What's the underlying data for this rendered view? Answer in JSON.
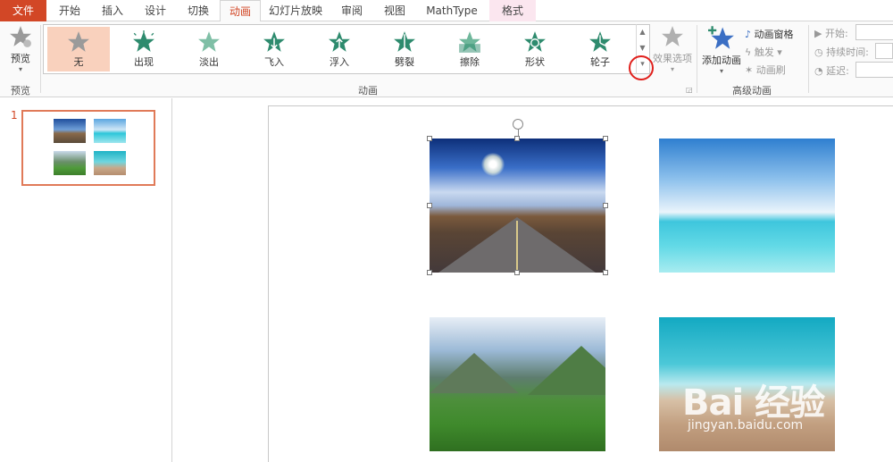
{
  "tabs": [
    {
      "label": "文件"
    },
    {
      "label": "开始"
    },
    {
      "label": "插入"
    },
    {
      "label": "设计"
    },
    {
      "label": "切换"
    },
    {
      "label": "动画"
    },
    {
      "label": "幻灯片放映"
    },
    {
      "label": "审阅"
    },
    {
      "label": "视图"
    },
    {
      "label": "MathType"
    },
    {
      "label": "格式"
    }
  ],
  "preview": {
    "label": "预览",
    "group_label": "预览"
  },
  "animations": {
    "group_label": "动画",
    "items": [
      {
        "label": "无",
        "icon": "star-none-icon",
        "selected": true
      },
      {
        "label": "出现",
        "icon": "star-appear-icon"
      },
      {
        "label": "淡出",
        "icon": "star-fade-icon"
      },
      {
        "label": "飞入",
        "icon": "star-fly-in-icon"
      },
      {
        "label": "浮入",
        "icon": "star-float-in-icon"
      },
      {
        "label": "劈裂",
        "icon": "star-split-icon"
      },
      {
        "label": "擦除",
        "icon": "star-wipe-icon"
      },
      {
        "label": "形状",
        "icon": "star-shape-icon"
      },
      {
        "label": "轮子",
        "icon": "star-wheel-icon"
      }
    ],
    "effect_options_label": "效果选项"
  },
  "advanced": {
    "group_label": "高级动画",
    "add_animation_label": "添加动画",
    "animation_pane_label": "动画窗格",
    "trigger_label": "触发",
    "painter_label": "动画刷"
  },
  "timing": {
    "start_label": "开始:",
    "duration_label": "持续时间:",
    "delay_label": "延迟:"
  },
  "slides_pane": {
    "slide_number": "1"
  },
  "watermark": {
    "logo_text": "Bai 经验",
    "url": "jingyan.baidu.com"
  },
  "colors": {
    "accent": "#d24726",
    "gallery_selected": "#f9d1bd",
    "star_green": "#2e8b6e",
    "highlight_circle": "#e0201c"
  }
}
